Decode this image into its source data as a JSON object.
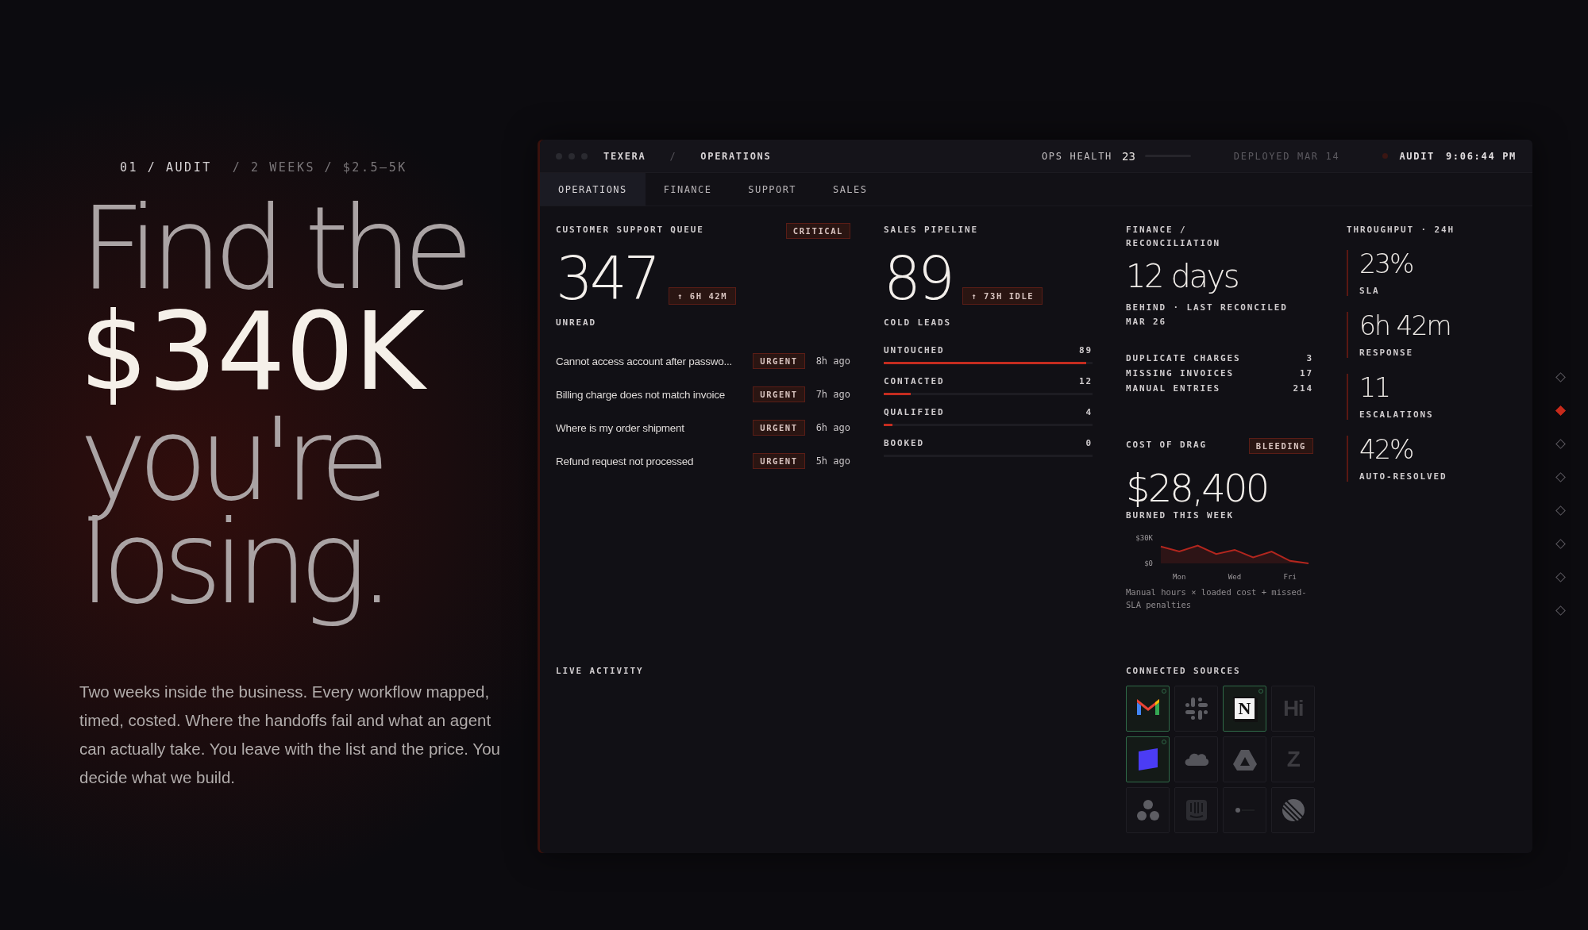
{
  "hero": {
    "eyebrow": "01 / AUDIT",
    "eyebrow_detail": "/ 2 WEEKS / $2.5–5K",
    "headline": [
      {
        "text": "Find the",
        "emphasis": false
      },
      {
        "text": "$340K",
        "emphasis": true
      },
      {
        "text": "you're",
        "emphasis": false
      },
      {
        "text": "losing.",
        "emphasis": false
      }
    ],
    "body": "Two weeks inside the business. Every workflow mapped, timed, costed. Where the handoffs fail and what an agent can actually take. You leave with the list and the price. You decide what we build."
  },
  "window": {
    "breadcrumb": [
      "TEXERA",
      "/",
      "OPERATIONS"
    ],
    "health_label": "OPS HEALTH",
    "health_value": "23",
    "deployed": "DEPLOYED MAR 14",
    "audit_label": "AUDIT",
    "clock": "9:06:44 PM"
  },
  "tabs": [
    {
      "label": "OPERATIONS",
      "selected": true
    },
    {
      "label": "FINANCE",
      "selected": false
    },
    {
      "label": "SUPPORT",
      "selected": false
    },
    {
      "label": "SALES",
      "selected": false
    }
  ],
  "support": {
    "title": "CUSTOMER SUPPORT QUEUE",
    "badge": "CRITICAL",
    "value": "347",
    "delta": "↑ 6H 42M",
    "caption": "UNREAD",
    "tickets": [
      {
        "subject": "Cannot access account after passwo...",
        "tag": "URGENT",
        "age": "8h ago"
      },
      {
        "subject": "Billing charge does not match invoice",
        "tag": "URGENT",
        "age": "7h ago"
      },
      {
        "subject": "Where is my order shipment",
        "tag": "URGENT",
        "age": "6h ago"
      },
      {
        "subject": "Refund request not processed",
        "tag": "URGENT",
        "age": "5h ago"
      }
    ]
  },
  "pipeline": {
    "title": "SALES PIPELINE",
    "value": "89",
    "delta": "↑ 73H IDLE",
    "caption": "COLD LEADS",
    "stages": [
      {
        "name": "UNTOUCHED",
        "count": "89",
        "level": 0.97
      },
      {
        "name": "CONTACTED",
        "count": "12",
        "level": 0.13
      },
      {
        "name": "QUALIFIED",
        "count": "4",
        "level": 0.04
      },
      {
        "name": "BOOKED",
        "count": "0",
        "level": 0
      }
    ]
  },
  "finance": {
    "title": "FINANCE / RECONCILIATION",
    "value": "12 days",
    "caption": "BEHIND · LAST RECONCILED MAR 26",
    "items": [
      {
        "name": "DUPLICATE CHARGES",
        "count": "3"
      },
      {
        "name": "MISSING INVOICES",
        "count": "17"
      },
      {
        "name": "MANUAL ENTRIES",
        "count": "214"
      }
    ]
  },
  "cost": {
    "title": "COST OF DRAG",
    "badge": "BLEEDING",
    "value": "$28,400",
    "caption": "BURNED THIS WEEK",
    "chart_data": {
      "type": "area",
      "categories": [
        null,
        "Mon",
        null,
        null,
        "Wed",
        null,
        null,
        "Fri",
        null
      ],
      "series": [
        {
          "color": "#b3261e",
          "values": [
            20,
            14,
            21,
            11,
            16,
            7,
            14,
            3,
            0
          ]
        }
      ],
      "ylim": [
        0,
        30
      ],
      "yticks": [
        {
          "value": 30,
          "label": "$30K"
        },
        {
          "value": 0,
          "label": "$0"
        }
      ]
    },
    "note": "Manual hours × loaded cost + missed-SLA penalties"
  },
  "throughput": {
    "title": "THROUGHPUT · 24H",
    "metrics": [
      {
        "value": "23%",
        "label": "SLA"
      },
      {
        "value": "6h 42m",
        "label": "RESPONSE"
      },
      {
        "value": "11",
        "label": "ESCALATIONS"
      },
      {
        "value": "42%",
        "label": "AUTO-RESOLVED"
      }
    ]
  },
  "activity": {
    "title": "LIVE ACTIVITY"
  },
  "sources": {
    "title": "CONNECTED SOURCES",
    "items": [
      {
        "kind": "mail",
        "connected": true
      },
      {
        "kind": "hash",
        "connected": false
      },
      {
        "kind": "letter",
        "glyph": "N",
        "connected": true
      },
      {
        "kind": "word",
        "glyph": "Hi",
        "connected": false
      },
      {
        "kind": "slab",
        "connected": true
      },
      {
        "kind": "cloud",
        "connected": false
      },
      {
        "kind": "triangle",
        "connected": false
      },
      {
        "kind": "word",
        "glyph": "Z",
        "connected": false
      },
      {
        "kind": "dots",
        "connected": false
      },
      {
        "kind": "bars",
        "connected": false
      },
      {
        "kind": "dot-line",
        "connected": false
      },
      {
        "kind": "striped-circle",
        "connected": false
      }
    ]
  },
  "nav_dots": [
    {
      "selected": false
    },
    {
      "selected": true
    },
    {
      "selected": false
    },
    {
      "selected": false
    },
    {
      "selected": false
    },
    {
      "selected": false
    },
    {
      "selected": false
    },
    {
      "selected": false
    }
  ]
}
